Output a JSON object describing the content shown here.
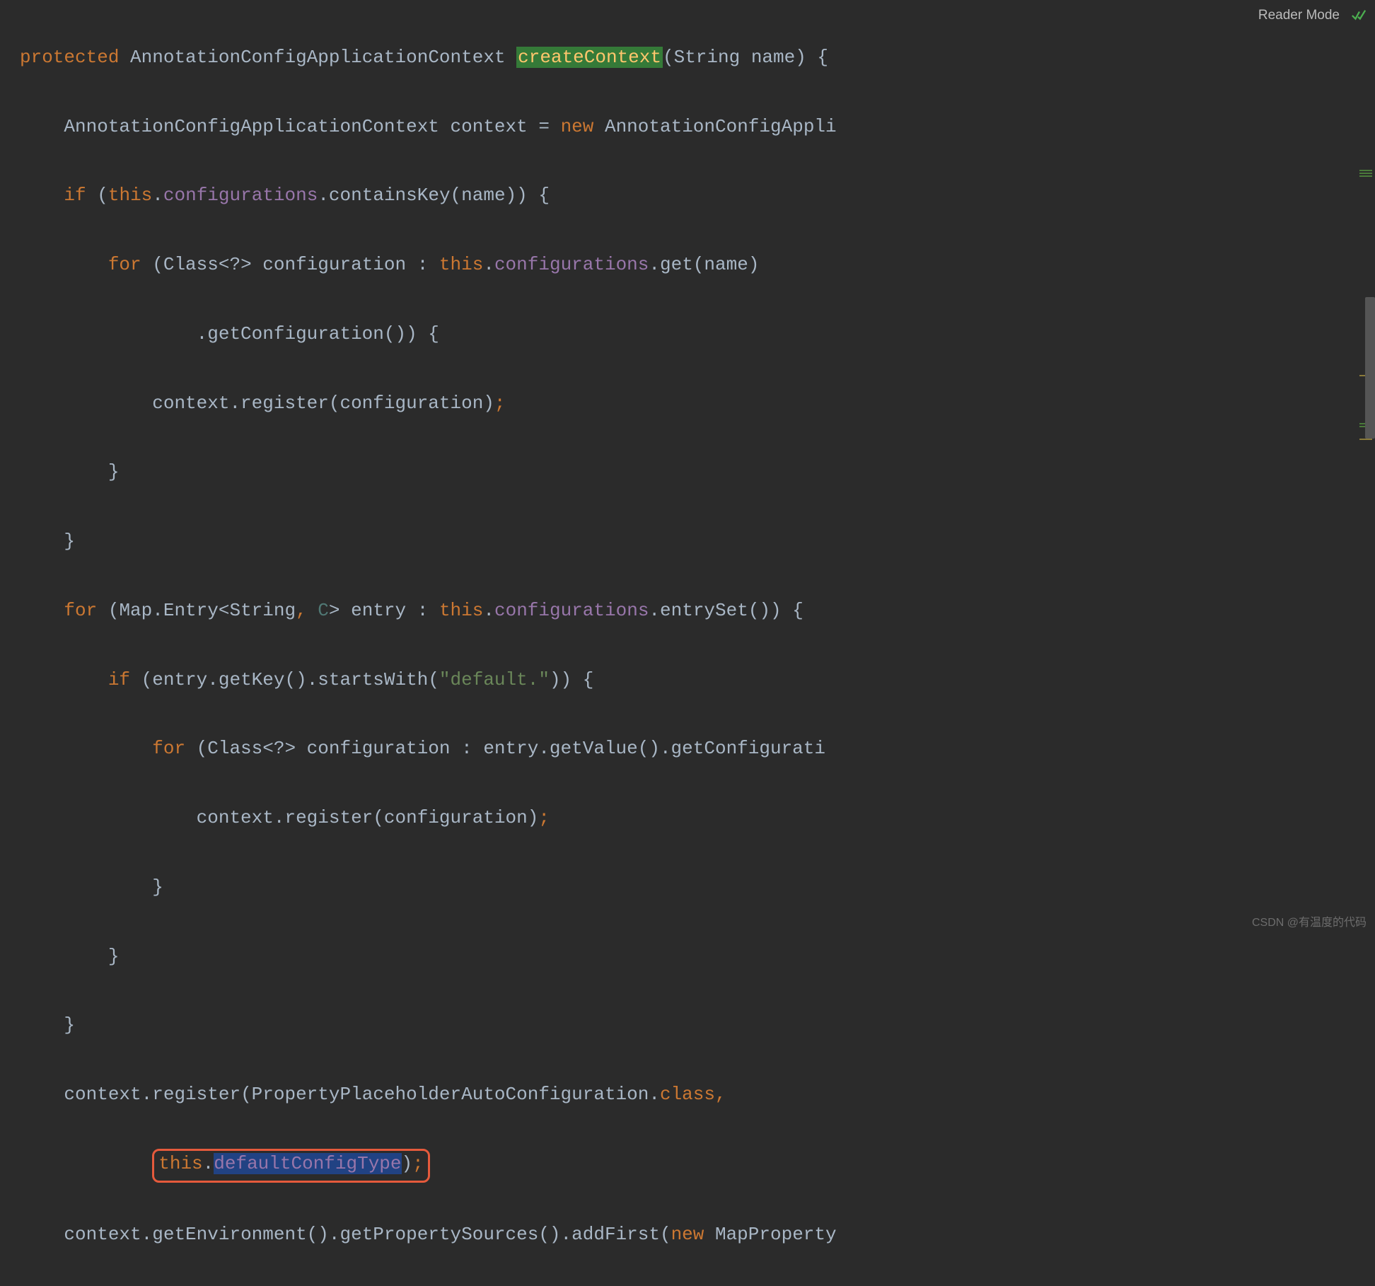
{
  "header": {
    "reader_mode": "Reader Mode"
  },
  "code": {
    "line1": {
      "kw_protected": "protected",
      "type1": "AnnotationConfigApplicationContext",
      "method": "createContext",
      "params": "(String name) {"
    },
    "line2": {
      "type1": "AnnotationConfigApplicationContext",
      "var": " context = ",
      "kw_new": "new",
      "type2": " AnnotationConfigAppli"
    },
    "line3": {
      "kw_if": "if",
      "open": " (",
      "kw_this": "this",
      "dot": ".",
      "field": "configurations",
      "rest": ".containsKey(name)) {"
    },
    "line4": {
      "kw_for": "for",
      "open": " (Class<?> configuration : ",
      "kw_this": "this",
      "dot": ".",
      "field": "configurations",
      "rest": ".get(name)"
    },
    "line5": {
      "text": ".getConfiguration()) {"
    },
    "line6": {
      "text": "context.register(configuration)",
      "semi": ";"
    },
    "line7": {
      "brace": "}"
    },
    "line8": {
      "brace": "}"
    },
    "line9": {
      "kw_for": "for",
      "open": " (Map.Entry<String",
      "comma": ",",
      "generic": " C",
      "close": "> entry : ",
      "kw_this": "this",
      "dot": ".",
      "field": "configurations",
      "rest": ".entrySet()) {"
    },
    "line10": {
      "kw_if": "if",
      "open": " (entry.getKey().startsWith(",
      "string": "\"default.\"",
      "rest": ")) {"
    },
    "line11": {
      "kw_for": "for",
      "rest": " (Class<?> configuration : entry.getValue().getConfigurati"
    },
    "line12": {
      "text": "context.register(configuration)",
      "semi": ";"
    },
    "line13": {
      "brace": "}"
    },
    "line14": {
      "brace": "}"
    },
    "line15": {
      "brace": "}"
    },
    "line16": {
      "text1": "context.register(PropertyPlaceholderAutoConfiguration.",
      "kw_class": "class",
      "comma": ","
    },
    "line17": {
      "kw_this": "this",
      "dot": ".",
      "field": "defaultConfigType",
      "close": ")",
      "semi": ";"
    },
    "line18": {
      "text": "context.getEnvironment().getPropertySources().addFirst(",
      "kw_new": "new",
      "rest": " MapProperty"
    }
  },
  "watermark": "CSDN @有温度的代码"
}
